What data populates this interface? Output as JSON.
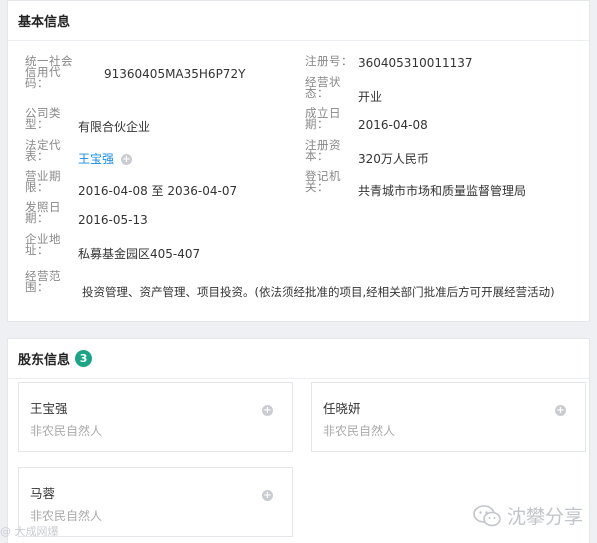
{
  "basic": {
    "title": "基本信息",
    "credit_code_label": "统一社会信用代码：",
    "credit_code": "91360405MA35H6P72Y",
    "reg_no_label": "注册号：",
    "reg_no": "360405310011137",
    "op_status_label": "经营状态：",
    "op_status": "开业",
    "company_type_label": "公司类型：",
    "company_type": "有限合伙企业",
    "established_label": "成立日期：",
    "established": "2016-04-08",
    "legal_rep_label": "法定代表：",
    "legal_rep": "王宝强",
    "reg_capital_label": "注册资本：",
    "reg_capital": "320万人民币",
    "biz_term_label": "营业期限：",
    "biz_term": "2016-04-08 至 2036-04-07",
    "reg_authority_label": "登记机关：",
    "reg_authority": "共青城市市场和质量监督管理局",
    "issue_date_label": "发照日期：",
    "issue_date": "2016-05-13",
    "address_label": "企业地址：",
    "address": "私募基金园区405-407",
    "scope_label": "经营范围：",
    "scope": "投资管理、资产管理、项目投资。(依法须经批准的项目,经相关部门批准后方可开展经营活动)"
  },
  "shareholders": {
    "title": "股东信息",
    "count": "3",
    "items": [
      {
        "name": "王宝强",
        "type": "非农民自然人"
      },
      {
        "name": "任晓妍",
        "type": "非农民自然人"
      },
      {
        "name": "马蓉",
        "type": "非农民自然人"
      }
    ]
  },
  "watermark": {
    "left": "@ 大成网爆",
    "right": "沈攀分享"
  },
  "icons": {
    "plus": "plus-circle-icon",
    "wechat": "wechat-icon"
  },
  "colors": {
    "link": "#128bed",
    "badge": "#1aa587"
  }
}
